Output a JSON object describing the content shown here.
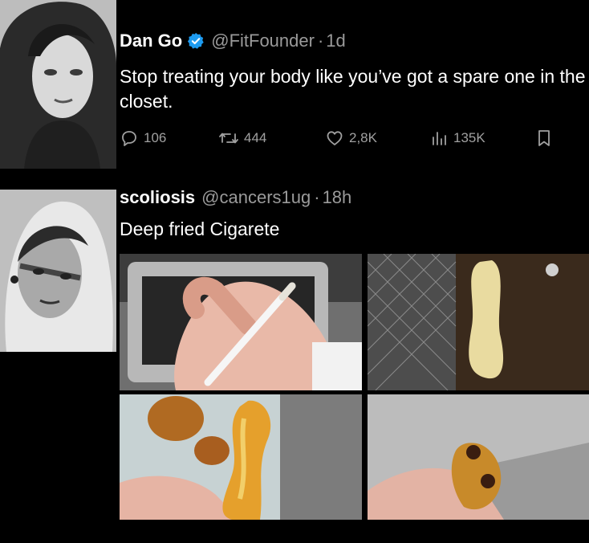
{
  "tweet1": {
    "name": "Dan Go",
    "handle": "@FitFounder",
    "separator": "·",
    "time": "1d",
    "text": "Stop treating your body like you’ve got a spare one in the closet.",
    "stats": {
      "replies": "106",
      "retweets": "444",
      "likes": "2,8K",
      "views": "135K"
    }
  },
  "tweet2": {
    "name": "scoliosis",
    "handle": "@cancers1ug",
    "separator": "·",
    "time": "18h",
    "text": "Deep fried Cigarete"
  },
  "colors": {
    "verified": "#1d9bf0",
    "muted_text": "#9a9a9a",
    "background": "#000000"
  },
  "icons": [
    "verified-badge-icon",
    "reply-icon",
    "retweet-icon",
    "like-icon",
    "views-icon",
    "bookmark-icon"
  ]
}
